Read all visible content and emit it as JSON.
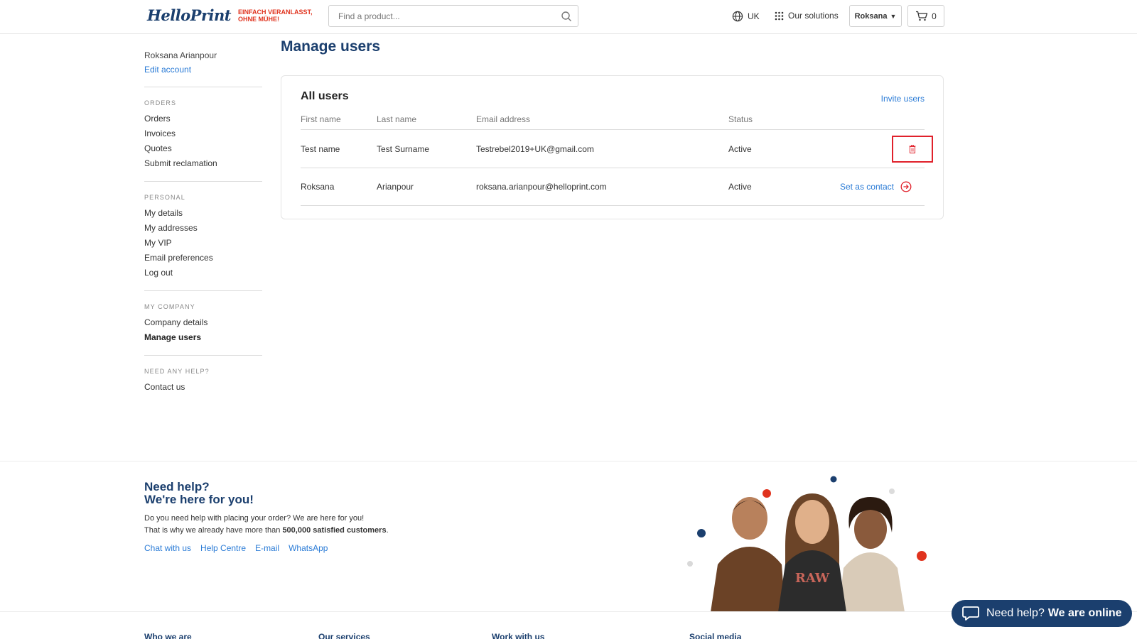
{
  "header": {
    "logo_text": "HelloPrint",
    "logo_tagline_1": "EINFACH VERANLASST,",
    "logo_tagline_2": "OHNE MÜHE!",
    "search_placeholder": "Find a product...",
    "region": "UK",
    "solutions": "Our solutions",
    "user": "Roksana",
    "cart_count": "0"
  },
  "sidebar": {
    "account_name": "Roksana Arianpour",
    "edit_account": "Edit account",
    "sections": [
      {
        "heading": "ORDERS",
        "items": [
          "Orders",
          "Invoices",
          "Quotes",
          "Submit reclamation"
        ]
      },
      {
        "heading": "PERSONAL",
        "items": [
          "My details",
          "My addresses",
          "My VIP",
          "Email preferences",
          "Log out"
        ]
      },
      {
        "heading": "MY COMPANY",
        "items": [
          "Company details",
          "Manage users"
        ]
      },
      {
        "heading": "NEED ANY HELP?",
        "items": [
          "Contact us"
        ]
      }
    ]
  },
  "main": {
    "title": "Manage users",
    "card_title": "All users",
    "invite": "Invite users",
    "columns": [
      "First name",
      "Last name",
      "Email address",
      "Status"
    ],
    "rows": [
      {
        "first": "Test name",
        "last": "Test Surname",
        "email": "Testrebel2019+UK@gmail.com",
        "status": "Active",
        "action": "delete"
      },
      {
        "first": "Roksana",
        "last": "Arianpour",
        "email": "roksana.arianpour@helloprint.com",
        "status": "Active",
        "action": "Set as contact"
      }
    ]
  },
  "help": {
    "title_1": "Need help?",
    "title_2": "We're here for you!",
    "text_1": "Do you need help with placing your order? We are here for you!",
    "text_2_pre": "That is why we already have more than ",
    "text_2_bold": "500,000 satisfied customers",
    "text_2_post": ".",
    "links": [
      "Chat with us",
      "Help Centre",
      "E-mail",
      "WhatsApp"
    ]
  },
  "footer": {
    "headings": [
      "Who we are",
      "Our services",
      "Work with us",
      "Social media"
    ]
  },
  "chat": {
    "label": "Need help?",
    "bold": "We are online"
  },
  "colors": {
    "brand_blue": "#1b3f6e",
    "link_blue": "#2a7bd6",
    "accent_red": "#e0331e",
    "highlight_red": "#e0212b"
  }
}
